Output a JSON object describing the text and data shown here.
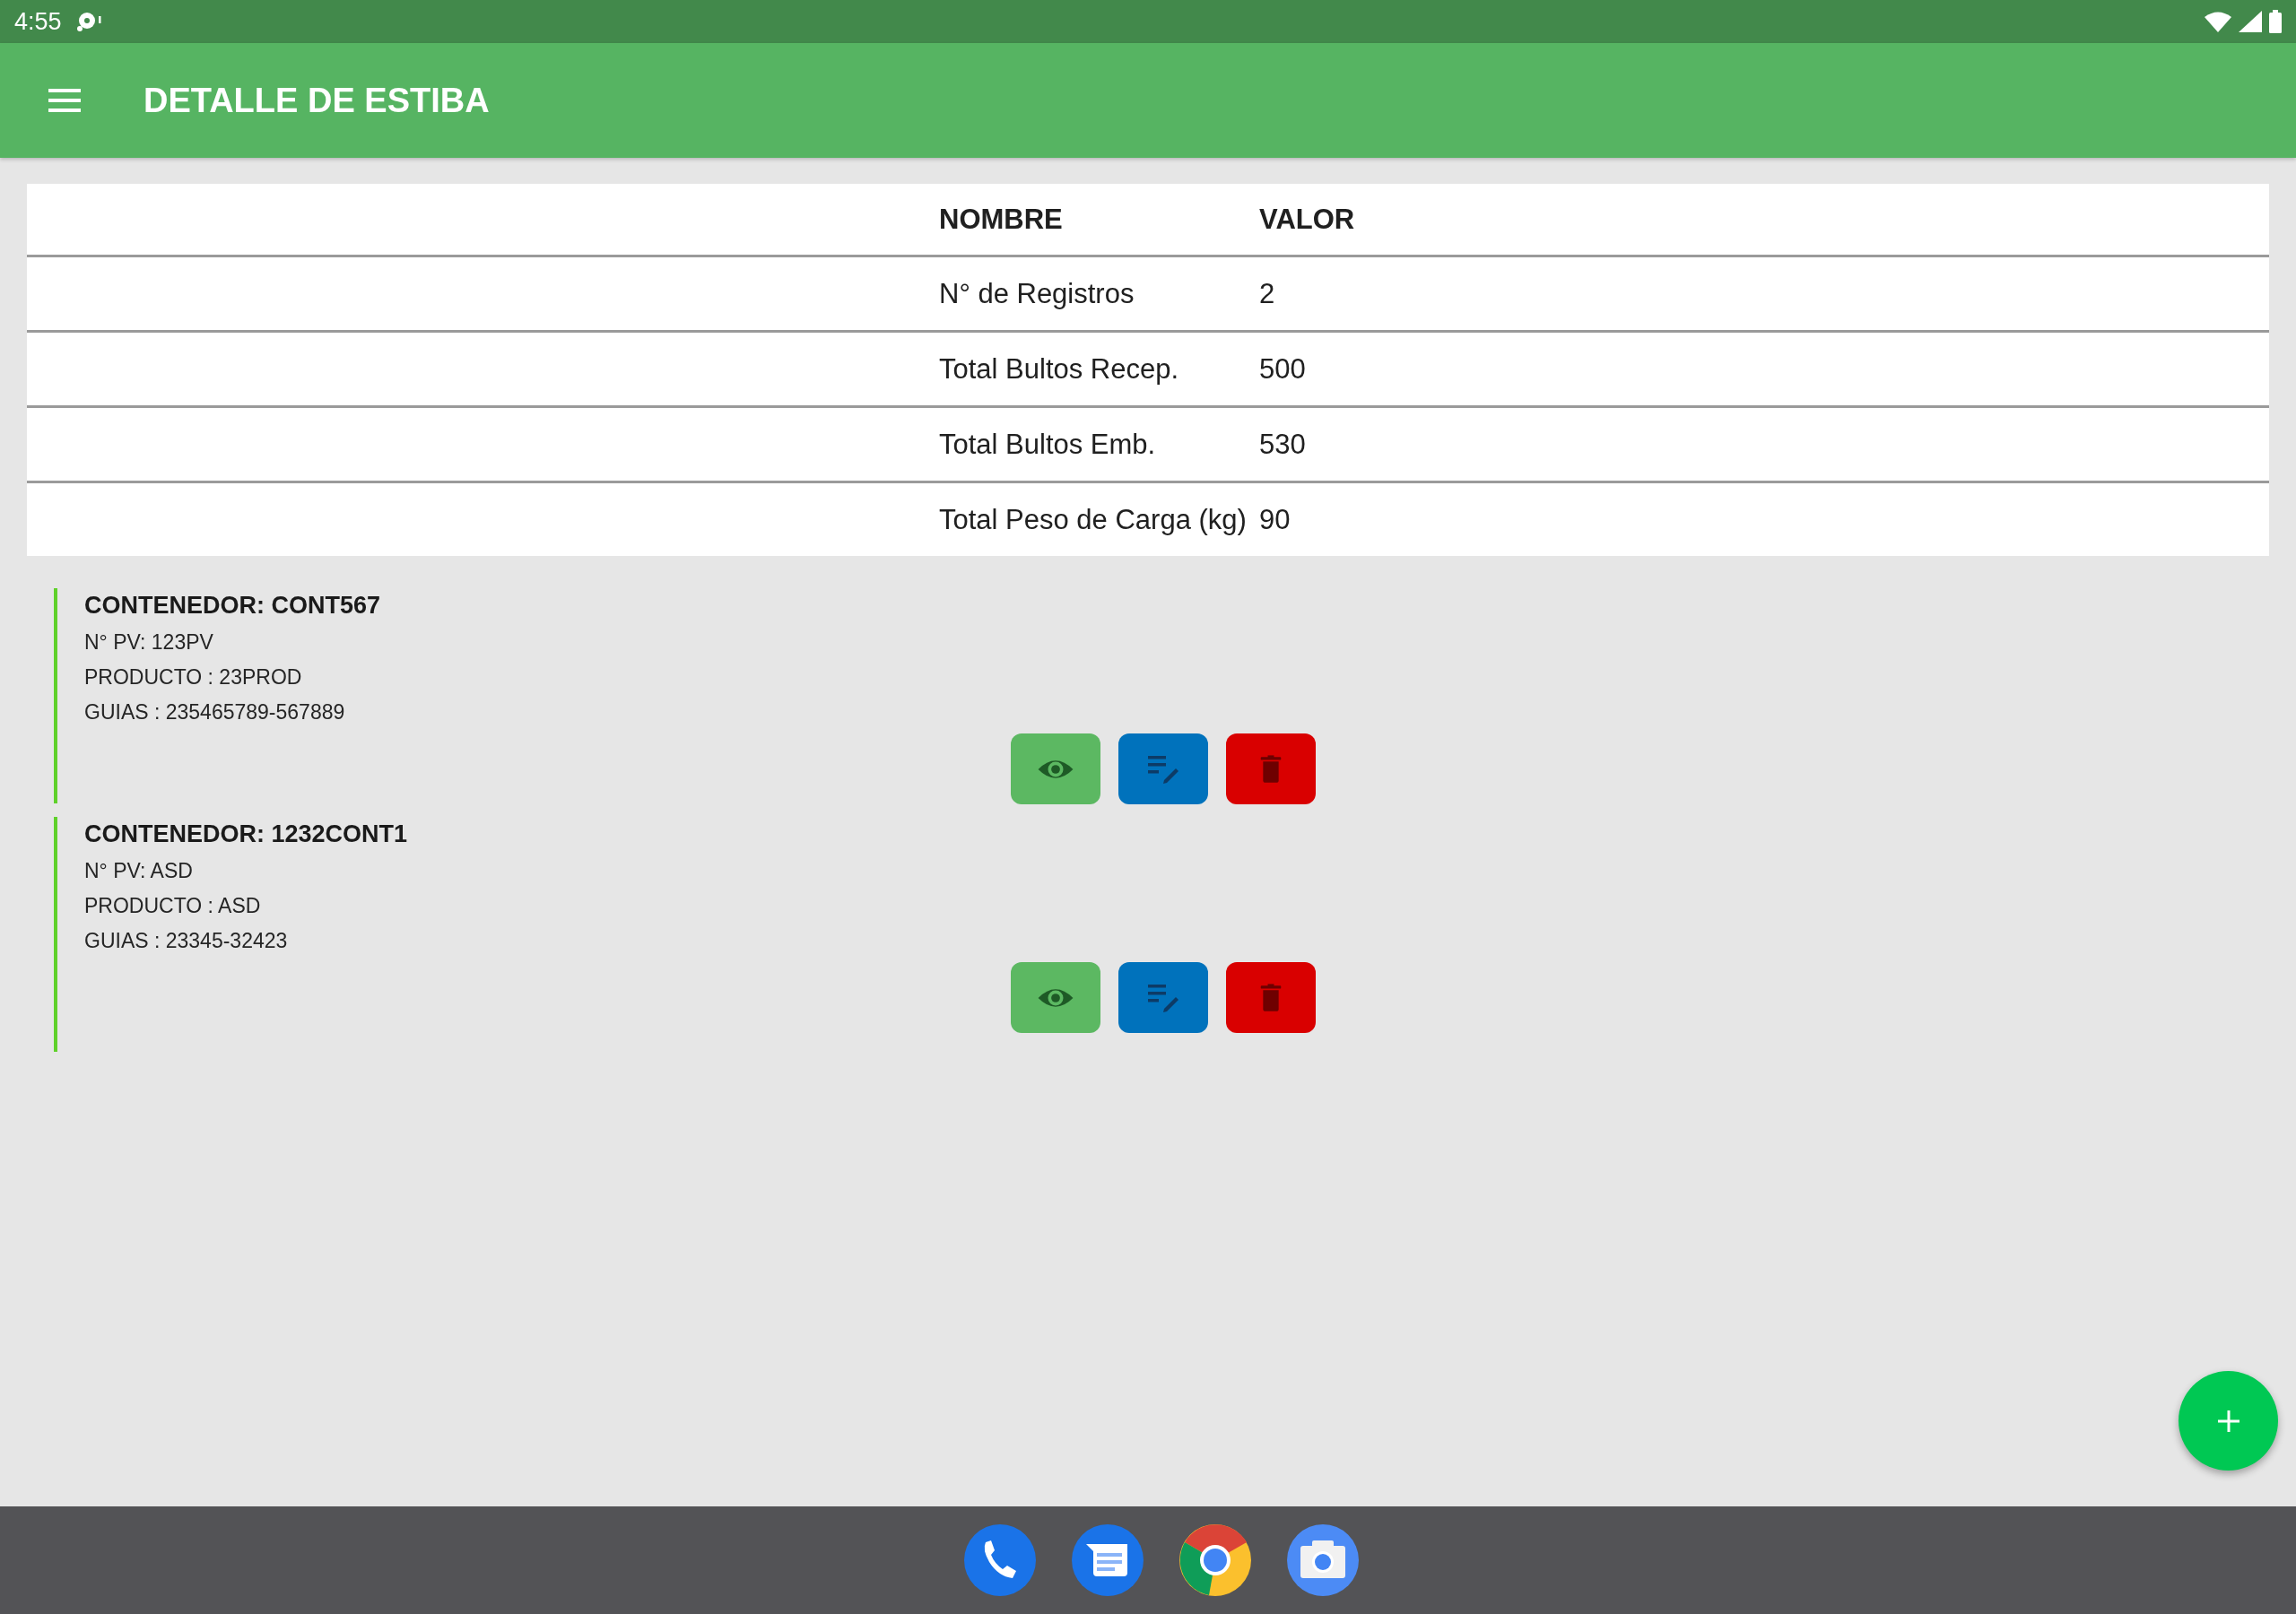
{
  "status_bar": {
    "time": "4:55"
  },
  "app_bar": {
    "title": "DETALLE DE ESTIBA"
  },
  "table": {
    "columns": [
      "NOMBRE",
      "VALOR"
    ],
    "rows": [
      [
        "N° de Registros",
        "2"
      ],
      [
        "Total Bultos Recep.",
        "500"
      ],
      [
        "Total Bultos Emb.",
        "530"
      ],
      [
        "Total Peso de Carga (kg)",
        "90"
      ]
    ]
  },
  "containers": [
    {
      "title": "CONTENEDOR: CONT567",
      "lines": [
        "N° PV: 123PV",
        "PRODUCTO : 23PROD",
        "GUIAS : 235465789-567889"
      ],
      "actions": [
        {
          "kind": "view"
        },
        {
          "kind": "edit"
        },
        {
          "kind": "delete"
        }
      ]
    },
    {
      "title": "CONTENEDOR: 1232CONT1",
      "lines": [
        "N° PV: ASD",
        "PRODUCTO : ASD",
        "GUIAS : 23345-32423"
      ],
      "actions": [
        {
          "kind": "view"
        },
        {
          "kind": "edit"
        },
        {
          "kind": "delete"
        }
      ]
    }
  ],
  "dock": [
    {
      "kind": "phone"
    },
    {
      "kind": "messages"
    },
    {
      "kind": "browser"
    },
    {
      "kind": "camera"
    }
  ]
}
